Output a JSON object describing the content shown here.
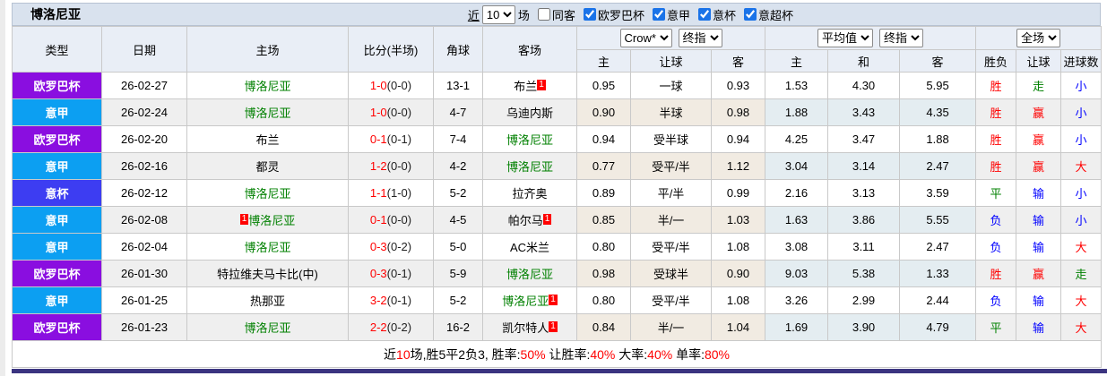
{
  "titlebar": {
    "title": "博洛尼亚",
    "near_label": "近",
    "near_value": "10",
    "games_label": "场",
    "same_away_label": "同客",
    "leagues": [
      {
        "label": "欧罗巴杯",
        "checked": true
      },
      {
        "label": "意甲",
        "checked": true
      },
      {
        "label": "意杯",
        "checked": true
      },
      {
        "label": "意超杯",
        "checked": true
      }
    ]
  },
  "dropdowns": {
    "crow": "Crow*",
    "crow_final": "终指",
    "avg": "平均值",
    "avg_final": "终指",
    "scope": "全场"
  },
  "columns": [
    "类型",
    "日期",
    "主场",
    "比分(半场)",
    "角球",
    "客场",
    "主",
    "让球",
    "客",
    "主",
    "和",
    "客",
    "胜负",
    "让球",
    "进球数"
  ],
  "colors": {
    "europa": "#8a0ee0",
    "seriea": "#0c9ff2",
    "coppa": "#3d3df2",
    "red": "#ff0000",
    "green": "#008000",
    "blue": "#0000ff",
    "team_green": "#008000",
    "badge": "#ff0000"
  },
  "rows": [
    {
      "type": "欧罗巴杯",
      "key": "europa",
      "date": "26-02-27",
      "home": {
        "name": "博洛尼亚",
        "green": true
      },
      "score": [
        "1-0",
        "(0-0)"
      ],
      "corner": "13-1",
      "away": {
        "name": "布兰",
        "badge": "1"
      },
      "crow": [
        "0.95",
        "一球",
        "0.93"
      ],
      "avg": [
        "1.53",
        "4.30",
        "5.95"
      ],
      "res": [
        [
          "胜",
          "r"
        ],
        [
          "走",
          "g"
        ],
        [
          "小",
          "b"
        ]
      ]
    },
    {
      "type": "意甲",
      "key": "seriea",
      "date": "26-02-24",
      "home": {
        "name": "博洛尼亚",
        "green": true
      },
      "score": [
        "1-0",
        "(0-0)"
      ],
      "corner": "4-7",
      "away": {
        "name": "乌迪内斯"
      },
      "crow": [
        "0.90",
        "半球",
        "0.98"
      ],
      "avg": [
        "1.88",
        "3.43",
        "4.35"
      ],
      "res": [
        [
          "胜",
          "r"
        ],
        [
          "赢",
          "r"
        ],
        [
          "小",
          "b"
        ]
      ]
    },
    {
      "type": "欧罗巴杯",
      "key": "europa",
      "date": "26-02-20",
      "home": {
        "name": "布兰"
      },
      "score": [
        "0-1",
        "(0-1)"
      ],
      "corner": "7-4",
      "away": {
        "name": "博洛尼亚",
        "green": true
      },
      "crow": [
        "0.94",
        "受半球",
        "0.94"
      ],
      "avg": [
        "4.25",
        "3.47",
        "1.88"
      ],
      "res": [
        [
          "胜",
          "r"
        ],
        [
          "赢",
          "r"
        ],
        [
          "小",
          "b"
        ]
      ]
    },
    {
      "type": "意甲",
      "key": "seriea",
      "date": "26-02-16",
      "home": {
        "name": "都灵"
      },
      "score": [
        "1-2",
        "(0-0)"
      ],
      "corner": "4-2",
      "away": {
        "name": "博洛尼亚",
        "green": true
      },
      "crow": [
        "0.77",
        "受平/半",
        "1.12"
      ],
      "avg": [
        "3.04",
        "3.14",
        "2.47"
      ],
      "res": [
        [
          "胜",
          "r"
        ],
        [
          "赢",
          "r"
        ],
        [
          "大",
          "r"
        ]
      ]
    },
    {
      "type": "意杯",
      "key": "coppa",
      "date": "26-02-12",
      "home": {
        "name": "博洛尼亚",
        "green": true
      },
      "score": [
        "1-1",
        "(1-0)"
      ],
      "corner": "5-2",
      "away": {
        "name": "拉齐奥"
      },
      "crow": [
        "0.89",
        "平/半",
        "0.99"
      ],
      "avg": [
        "2.16",
        "3.13",
        "3.59"
      ],
      "res": [
        [
          "平",
          "g"
        ],
        [
          "输",
          "b"
        ],
        [
          "小",
          "b"
        ]
      ]
    },
    {
      "type": "意甲",
      "key": "seriea",
      "date": "26-02-08",
      "home": {
        "name": "博洛尼亚",
        "green": true,
        "badge": "1",
        "badge_before": true
      },
      "score": [
        "0-1",
        "(0-0)"
      ],
      "corner": "4-5",
      "away": {
        "name": "帕尔马",
        "badge": "1"
      },
      "crow": [
        "0.85",
        "半/一",
        "1.03"
      ],
      "avg": [
        "1.63",
        "3.86",
        "5.55"
      ],
      "res": [
        [
          "负",
          "b"
        ],
        [
          "输",
          "b"
        ],
        [
          "小",
          "b"
        ]
      ]
    },
    {
      "type": "意甲",
      "key": "seriea",
      "date": "26-02-04",
      "home": {
        "name": "博洛尼亚",
        "green": true
      },
      "score": [
        "0-3",
        "(0-2)"
      ],
      "corner": "5-0",
      "away": {
        "name": "AC米兰"
      },
      "crow": [
        "0.80",
        "受平/半",
        "1.08"
      ],
      "avg": [
        "3.08",
        "3.11",
        "2.47"
      ],
      "res": [
        [
          "负",
          "b"
        ],
        [
          "输",
          "b"
        ],
        [
          "大",
          "r"
        ]
      ]
    },
    {
      "type": "欧罗巴杯",
      "key": "europa",
      "date": "26-01-30",
      "home": {
        "name": "特拉维夫马卡比(中)"
      },
      "score": [
        "0-3",
        "(0-1)"
      ],
      "corner": "5-9",
      "away": {
        "name": "博洛尼亚",
        "green": true
      },
      "crow": [
        "0.98",
        "受球半",
        "0.90"
      ],
      "avg": [
        "9.03",
        "5.38",
        "1.33"
      ],
      "res": [
        [
          "胜",
          "r"
        ],
        [
          "赢",
          "r"
        ],
        [
          "走",
          "g"
        ]
      ]
    },
    {
      "type": "意甲",
      "key": "seriea",
      "date": "26-01-25",
      "home": {
        "name": "热那亚"
      },
      "score": [
        "3-2",
        "(0-1)"
      ],
      "corner": "5-2",
      "away": {
        "name": "博洛尼亚",
        "green": true,
        "badge": "1"
      },
      "crow": [
        "0.80",
        "受平/半",
        "1.08"
      ],
      "avg": [
        "3.26",
        "2.99",
        "2.44"
      ],
      "res": [
        [
          "负",
          "b"
        ],
        [
          "输",
          "b"
        ],
        [
          "大",
          "r"
        ]
      ]
    },
    {
      "type": "欧罗巴杯",
      "key": "europa",
      "date": "26-01-23",
      "home": {
        "name": "博洛尼亚",
        "green": true
      },
      "score": [
        "2-2",
        "(0-2)"
      ],
      "corner": "16-2",
      "away": {
        "name": "凯尔特人",
        "badge": "1"
      },
      "crow": [
        "0.84",
        "半/一",
        "1.04"
      ],
      "avg": [
        "1.69",
        "3.90",
        "4.79"
      ],
      "res": [
        [
          "平",
          "g"
        ],
        [
          "输",
          "b"
        ],
        [
          "大",
          "r"
        ]
      ]
    }
  ],
  "summary": [
    {
      "text": "近",
      "red": false
    },
    {
      "text": "10",
      "red": true
    },
    {
      "text": "场,胜5平2负3, 胜率:",
      "red": false
    },
    {
      "text": "50%",
      "red": true
    },
    {
      "text": " 让胜率:",
      "red": false
    },
    {
      "text": "40%",
      "red": true
    },
    {
      "text": " 大率:",
      "red": false
    },
    {
      "text": "40%",
      "red": true
    },
    {
      "text": " 单率:",
      "red": false
    },
    {
      "text": "80%",
      "red": true
    }
  ]
}
